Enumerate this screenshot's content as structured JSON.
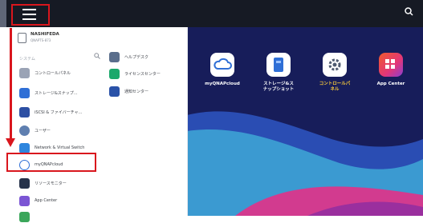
{
  "device": {
    "name": "NASHIFEDA",
    "model": "QNAPTS-873"
  },
  "section_label": "システム",
  "left_items": [
    {
      "label": "コントロールパネル",
      "icon": "control-panel-icon",
      "color": "#9aa3b5"
    },
    {
      "label": "ストレージ&スナップ...",
      "icon": "storage-icon",
      "color": "#2f6fd6"
    },
    {
      "label": "iSCSI & ファイバーチャ...",
      "icon": "iscsi-icon",
      "color": "#2c4fa3"
    },
    {
      "label": "ユーザー",
      "icon": "user-icon",
      "color": "#5f7fb0"
    },
    {
      "label": "Network & Virtual Switch",
      "icon": "network-icon",
      "color": "#2e86de"
    },
    {
      "label": "myQNAPcloud",
      "icon": "cloud-icon",
      "color": "#2f6fd6"
    },
    {
      "label": "リソースモニター",
      "icon": "resource-monitor-icon",
      "color": "#25324a"
    },
    {
      "label": "App Center",
      "icon": "app-center-icon",
      "color": "#7b55d4"
    }
  ],
  "right_items": [
    {
      "label": "ヘルプデスク",
      "icon": "helpdesk-icon",
      "color": "#5a6e8c"
    },
    {
      "label": "ライセンスセンター",
      "icon": "license-icon",
      "color": "#1aa86b"
    },
    {
      "label": "通知センター",
      "icon": "notification-icon",
      "color": "#2a52a8"
    }
  ],
  "desktop_apps": [
    {
      "label": "myQNAPcloud",
      "icon": "cloud-icon",
      "color": "#ffffff"
    },
    {
      "label": "ストレージ&ス\nナップショット",
      "icon": "storage-icon",
      "color": "#ffffff"
    },
    {
      "label": "コントロールパ\nネル",
      "icon": "gear-icon",
      "color": "#ffffff"
    },
    {
      "label": "App Center",
      "icon": "app-center-icon",
      "color": "#e2367a"
    }
  ],
  "colors": {
    "accent_red": "#d9161d",
    "topbar": "#161a24",
    "desktop_bg": "#151b53"
  }
}
